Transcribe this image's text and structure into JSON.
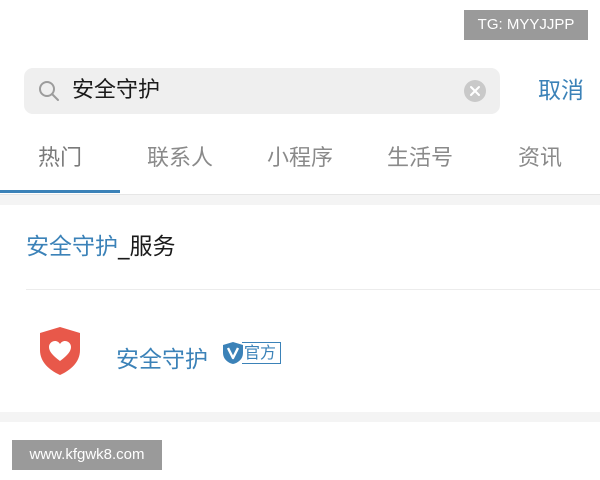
{
  "watermarks": {
    "top_right": "TG: MYYJJPP",
    "bottom_left": "www.kfgwk8.com"
  },
  "search": {
    "value": "安全守护",
    "cancel_label": "取消",
    "icon": "search-icon",
    "clear_icon": "clear-icon"
  },
  "tabs": [
    {
      "label": "热门",
      "active": true
    },
    {
      "label": "联系人",
      "active": false
    },
    {
      "label": "小程序",
      "active": false
    },
    {
      "label": "生活号",
      "active": false
    },
    {
      "label": "资讯",
      "active": false
    }
  ],
  "results": {
    "suggestion": {
      "highlight": "安全守护",
      "rest": "_服务"
    },
    "mini_program": {
      "name": "安全守护",
      "badge": "官方",
      "logo_icon": "shield-heart-icon",
      "badge_icon": "verified-v-icon"
    }
  },
  "colors": {
    "accent": "#3b82b8",
    "logo_red": "#e8584a",
    "search_bg": "#efefef"
  }
}
